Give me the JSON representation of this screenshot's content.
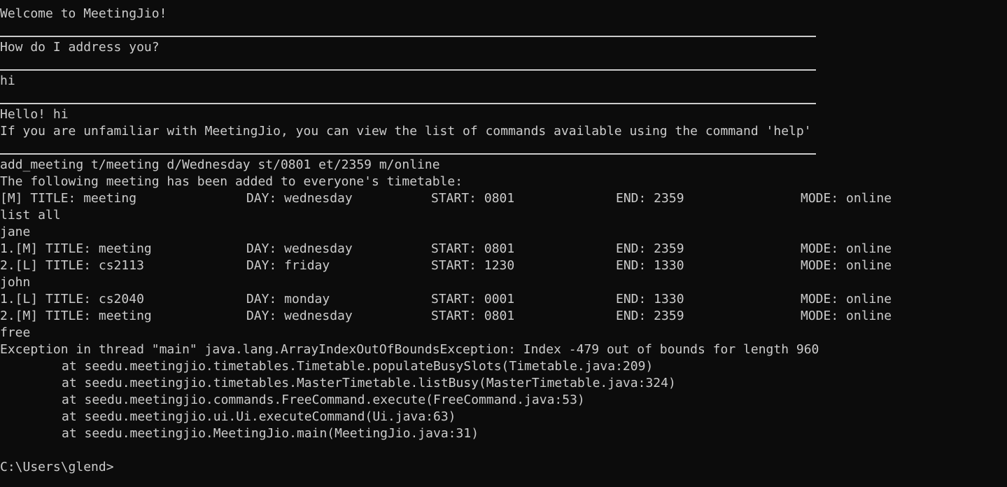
{
  "welcome": "Welcome to MeetingJio!",
  "ask_name": "How do I address you?",
  "user_name_input": "hi",
  "hello": "Hello! hi",
  "help_hint": "If you are unfamiliar with MeetingJio, you can view the list of commands available using the command 'help'",
  "add_command": "add_meeting t/meeting d/Wednesday st/0801 et/2359 m/online",
  "added_message": "The following meeting has been added to everyone's timetable:",
  "added_entry": {
    "title": "[M] TITLE: meeting",
    "day": "DAY: wednesday",
    "start": "START: 0801",
    "end": "END: 2359",
    "mode": "MODE: online"
  },
  "list_command": "list all",
  "users": [
    {
      "name": "jane",
      "entries": [
        {
          "title": "1.[M] TITLE: meeting",
          "day": "DAY: wednesday",
          "start": "START: 0801",
          "end": "END: 2359",
          "mode": "MODE: online"
        },
        {
          "title": "2.[L] TITLE: cs2113",
          "day": "DAY: friday",
          "start": "START: 1230",
          "end": "END: 1330",
          "mode": "MODE: online"
        }
      ]
    },
    {
      "name": "john",
      "entries": [
        {
          "title": "1.[L] TITLE: cs2040",
          "day": "DAY: monday",
          "start": "START: 0001",
          "end": "END: 1330",
          "mode": "MODE: online"
        },
        {
          "title": "2.[M] TITLE: meeting",
          "day": "DAY: wednesday",
          "start": "START: 0801",
          "end": "END: 2359",
          "mode": "MODE: online"
        }
      ]
    }
  ],
  "free_command": "free",
  "exception": "Exception in thread \"main\" java.lang.ArrayIndexOutOfBoundsException: Index -479 out of bounds for length 960",
  "stack_trace": [
    "at seedu.meetingjio.timetables.Timetable.populateBusySlots(Timetable.java:209)",
    "at seedu.meetingjio.timetables.MasterTimetable.listBusy(MasterTimetable.java:324)",
    "at seedu.meetingjio.commands.FreeCommand.execute(FreeCommand.java:53)",
    "at seedu.meetingjio.ui.Ui.executeCommand(Ui.java:63)",
    "at seedu.meetingjio.MeetingJio.main(MeetingJio.java:31)"
  ],
  "prompt": "C:\\Users\\glend>"
}
